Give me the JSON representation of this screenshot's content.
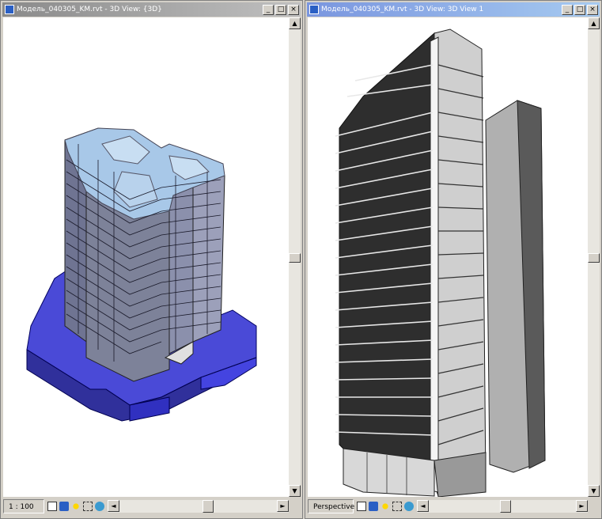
{
  "left_window": {
    "title": "Модель_040305_KM.rvt - 3D View: {3D}",
    "scale": "1 : 100",
    "buttons": {
      "minimize": "_",
      "maximize": "□",
      "close": "×"
    }
  },
  "right_window": {
    "title": "Модель_040305_KM.rvt - 3D View: 3D View 1",
    "scale": "Perspective",
    "buttons": {
      "minimize": "_",
      "maximize": "□",
      "close": "×"
    }
  },
  "scroll_arrows": {
    "up": "▲",
    "down": "▼",
    "left": "◄",
    "right": "►"
  },
  "status_icons": [
    "view-cube-icon",
    "model-graphics-icon",
    "shadows-icon",
    "crop-icon",
    "hide-isolate-icon"
  ]
}
